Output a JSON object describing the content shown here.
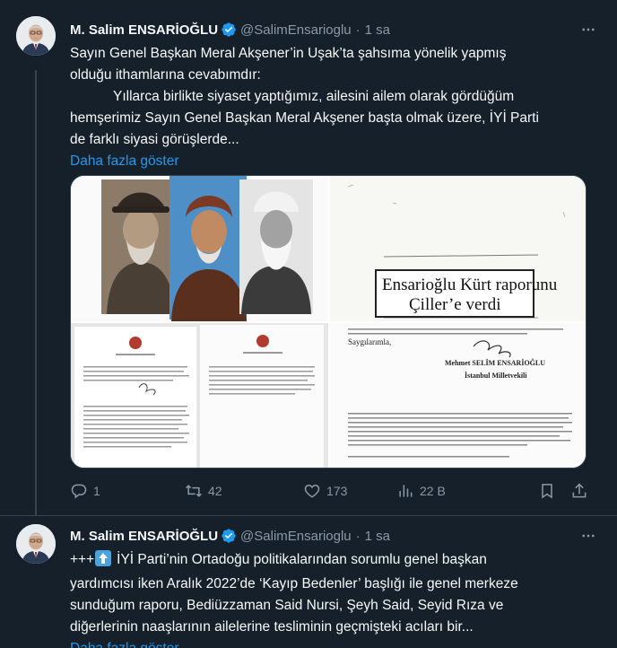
{
  "tweets": [
    {
      "author_name": "M. Salim ENSARİOĞLU",
      "handle": "@SalimEnsarioglu",
      "separator": "·",
      "time": "1 sa",
      "text_lines": [
        "Sayın Genel Başkan Meral Akşener’in Uşak’ta şahsıma yönelik yapmış",
        "olduğu ithamlarına cevabımdır:",
        "Yıllarca birlikte siyaset yaptığımız, ailesini ailem olarak gördüğüm",
        "hemşerimiz Sayın Genel Başkan Meral Akşener başta olmak üzere, İYİ Parti",
        "de farklı siyasi görüşlerde..."
      ],
      "show_more": "Daha fazla göster",
      "media": {
        "clipping_line1": "Ensarioğlu Kürt raporunu",
        "clipping_line2": "Çiller’e verdi",
        "doc_signature_name": "Mehmet SELİM ENSARİOĞLU",
        "doc_signature_title": "İstanbul Milletvekili",
        "doc_salute": "Saygılarımla,"
      },
      "stats": {
        "replies": "1",
        "retweets": "42",
        "likes": "173",
        "views": "22 B"
      }
    },
    {
      "author_name": "M. Salim ENSARİOĞLU",
      "handle": "@SalimEnsarioglu",
      "separator": "·",
      "time": "1 sa",
      "prefix": "+++",
      "text_lines": [
        "İYİ Parti’nin Ortadoğu politikalarından sorumlu genel başkan",
        "yardımcısı iken Aralık 2022’de ‘Kayıp Bedenler’ başlığı ile genel merkeze",
        "sunduğum raporu, Bediüzzaman Said Nursi, Şeyh Said, Seyid Rıza ve",
        "diğerlerinin naaşlarının ailelerine tesliminin geçmişteki acıları bir..."
      ],
      "show_more": "Daha fazla göster"
    }
  ],
  "colors": {
    "background": "#15202b",
    "text": "#f7f9f9",
    "muted": "#8b98a5",
    "link": "#1d9bf0",
    "verified": "#1d9bf0",
    "divider": "#38444d"
  },
  "icons": {
    "verified": "verified-badge-icon",
    "more": "more-icon",
    "reply": "reply-icon",
    "retweet": "retweet-icon",
    "like": "heart-icon",
    "views": "views-icon",
    "bookmark": "bookmark-icon",
    "share": "share-icon",
    "up_arrow_emoji": "up-arrow-emoji-icon"
  }
}
